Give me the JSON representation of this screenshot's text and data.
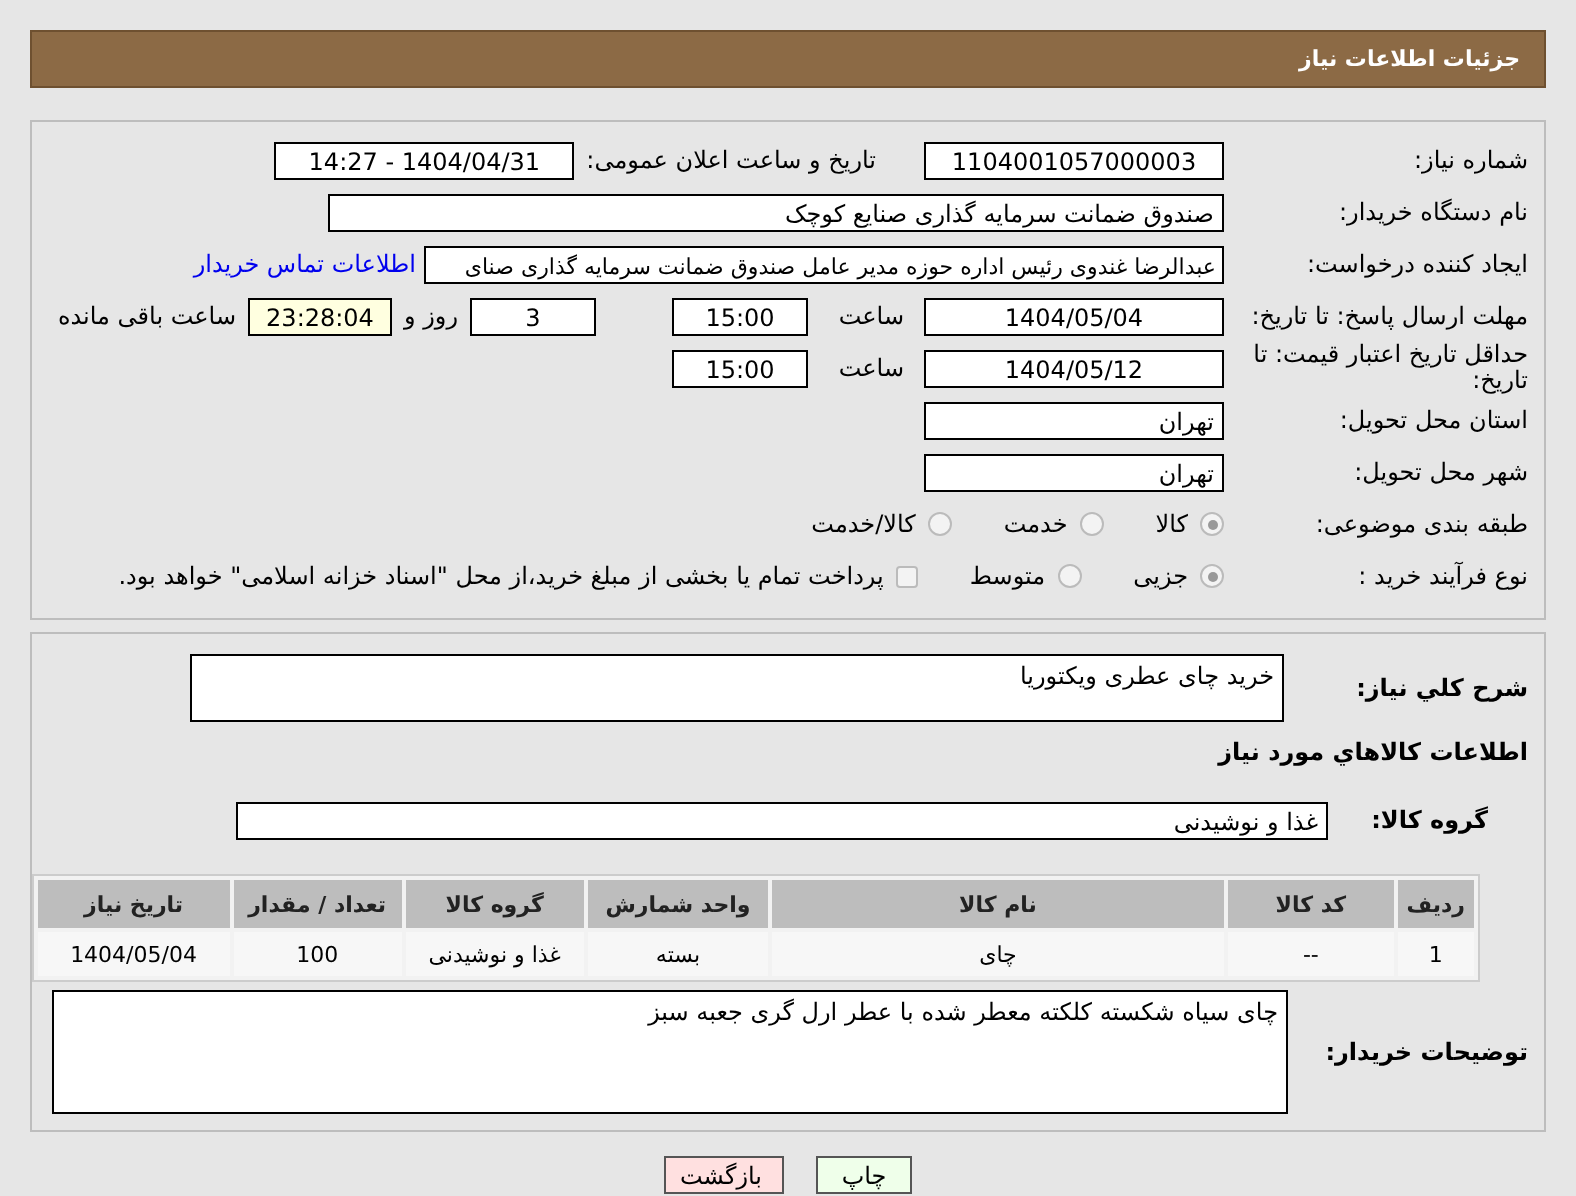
{
  "header": {
    "title": "جزئیات اطلاعات نیاز"
  },
  "details": {
    "need_number": {
      "label": "شماره نیاز:",
      "value": "1104001057000003"
    },
    "announce": {
      "label": "تاریخ و ساعت اعلان عمومی:",
      "value": "1404/04/31 - 14:27"
    },
    "buyer": {
      "label": "نام دستگاه خریدار:",
      "value": "صندوق ضمانت سرمایه گذاری صنایع کوچک"
    },
    "creator": {
      "label": "ایجاد کننده درخواست:",
      "value": "عبدالرضا غندوی رئیس اداره حوزه مدیر عامل صندوق ضمانت سرمایه گذاری صنای",
      "link": "اطلاعات تماس خریدار"
    },
    "deadline": {
      "label": "مهلت ارسال پاسخ: تا تاریخ:",
      "date": "1404/05/04",
      "time_label": "ساعت",
      "time": "15:00",
      "days": "3",
      "days_label": "روز و",
      "remaining": "23:28:04",
      "remaining_label": "ساعت باقی مانده"
    },
    "validity": {
      "label": "حداقل تاریخ اعتبار قیمت: تا تاریخ:",
      "date": "1404/05/12",
      "time_label": "ساعت",
      "time": "15:00"
    },
    "province": {
      "label": "استان محل تحویل:",
      "value": "تهران"
    },
    "city": {
      "label": "شهر محل تحویل:",
      "value": "تهران"
    },
    "category": {
      "label": "طبقه بندی موضوعی:",
      "options": [
        {
          "label": "کالا",
          "selected": true
        },
        {
          "label": "خدمت",
          "selected": false
        },
        {
          "label": "کالا/خدمت",
          "selected": false
        }
      ]
    },
    "process": {
      "label": "نوع فرآیند خرید :",
      "options": [
        {
          "label": "جزیی",
          "selected": true
        },
        {
          "label": "متوسط",
          "selected": false
        }
      ],
      "payment": {
        "label": "پرداخت تمام یا بخشی از مبلغ خرید،از محل \"اسناد خزانه اسلامی\" خواهد بود.",
        "checked": false
      }
    }
  },
  "goods": {
    "description": {
      "label": "شرح کلي نیاز:",
      "value": "خرید چای عطری ویکتوریا"
    },
    "heading": "اطلاعات کالاهاي مورد نیاز",
    "group": {
      "label": "گروه کالا:",
      "value": "غذا و نوشیدنی"
    },
    "table": {
      "columns": [
        "ردیف",
        "کد کالا",
        "نام کالا",
        "واحد شمارش",
        "گروه کالا",
        "تعداد / مقدار",
        "تاریخ نیاز"
      ],
      "rows": [
        [
          "1",
          "--",
          "چای",
          "بسته",
          "غذا و نوشیدنی",
          "100",
          "1404/05/04"
        ]
      ]
    },
    "notes": {
      "label": "توضیحات خریدار:",
      "value": "چای سیاه شکسته کلکته معطر شده با عطر ارل گری جعبه سبز"
    }
  },
  "buttons": [
    {
      "label": "چاپ",
      "kind": "print"
    },
    {
      "label": "بازگشت",
      "kind": "back"
    }
  ]
}
